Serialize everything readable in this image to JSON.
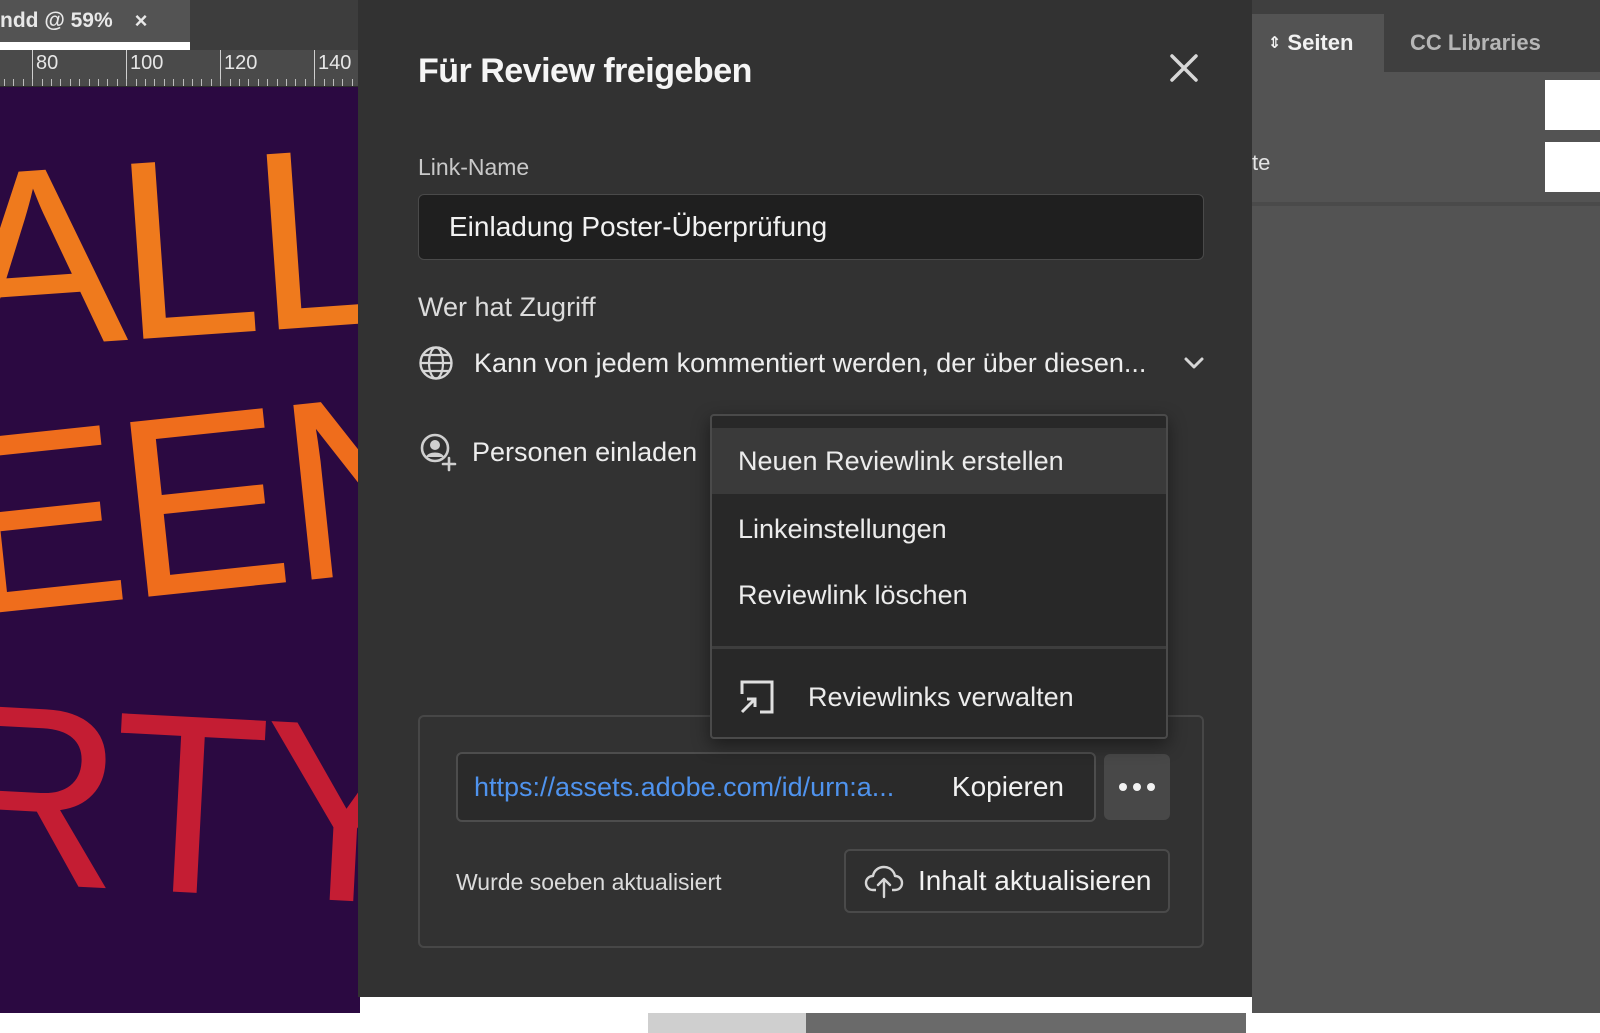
{
  "document": {
    "tab_title": "ndd @ 59%",
    "tab_close": "×",
    "ruler_labels": [
      "80",
      "100",
      "120",
      "140"
    ],
    "poster_lines": [
      "ALLO",
      "EEN",
      "RTY"
    ]
  },
  "right_panel": {
    "tabs": [
      {
        "label": "Seiten",
        "icon": "up-down-icon",
        "active": true
      },
      {
        "label": "CC Libraries",
        "active": false
      }
    ],
    "partial_text": "te"
  },
  "dialog": {
    "title": "Für Review freigeben",
    "link_name_label": "Link-Name",
    "link_name_value": "Einladung Poster-Überprüfung",
    "access_heading": "Wer hat Zugriff",
    "access_value": "Kann von jedem kommentiert werden, der über diesen...",
    "invite_label": "Personen einladen",
    "url": "https://assets.adobe.com/id/urn:a...",
    "copy_label": "Kopieren",
    "status_text": "Wurde soeben aktualisiert",
    "update_button_label": "Inhalt aktualisieren",
    "menu": {
      "items": [
        {
          "label": "Neuen Reviewlink erstellen"
        },
        {
          "label": "Linkeinstellungen"
        },
        {
          "label": "Reviewlink löschen"
        }
      ],
      "footer_item": {
        "label": "Reviewlinks verwalten",
        "icon": "open-external-icon"
      }
    }
  },
  "colors": {
    "dialog_bg": "#323232",
    "link_color": "#4f93ee",
    "poster_bg": "#2b0941",
    "poster_orange": "#ef7a1d",
    "poster_red": "#c41d33"
  }
}
